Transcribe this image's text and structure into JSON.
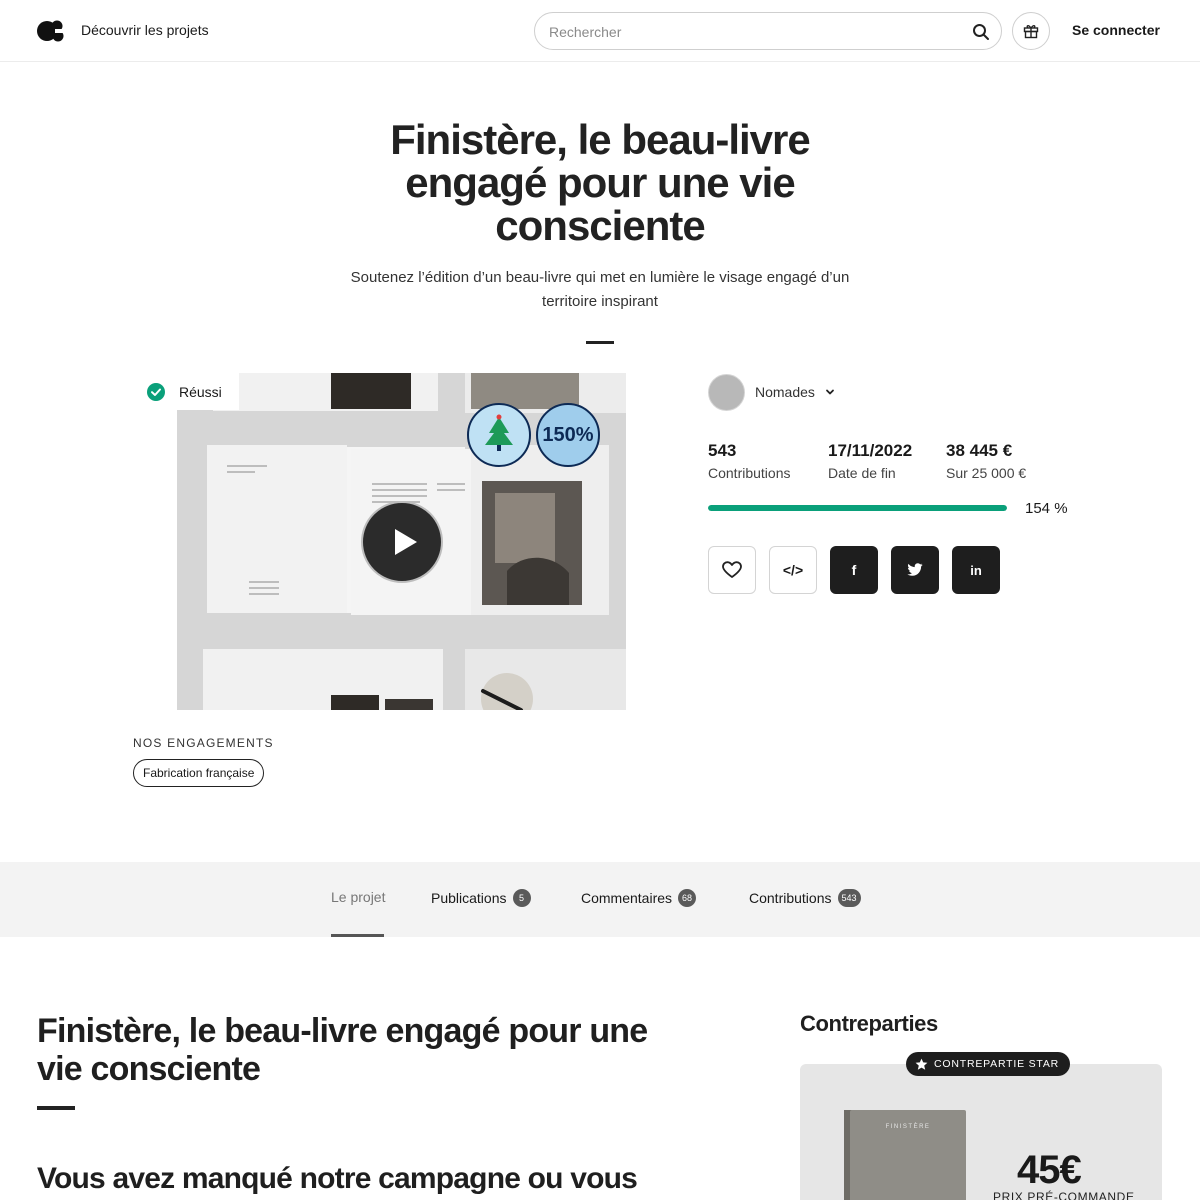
{
  "header": {
    "discover_label": "Découvrir les projets",
    "search_placeholder": "Rechercher",
    "login_label": "Se connecter"
  },
  "hero": {
    "title": "Finistère, le beau-livre engagé pour une vie consciente",
    "subtitle": "Soutenez l’édition d’un beau-livre qui met en lumière le visage engagé d’un territoire inspirant"
  },
  "media": {
    "status_label": "Réussi",
    "sticker_percent": "150%",
    "accent_color": "#0aa07a"
  },
  "owner": {
    "name": "Nomades"
  },
  "stats": [
    {
      "value": "543",
      "label": "Contributions"
    },
    {
      "value": "17/11/2022",
      "label": "Date de fin"
    },
    {
      "value": "38 445 €",
      "label": "Sur 25 000 €"
    }
  ],
  "progress": {
    "percent_label": "154 %",
    "fraction": 1.0
  },
  "actions": {
    "embed_label": "</>",
    "facebook_label": "f",
    "linkedin_label": "in"
  },
  "engagements": {
    "title": "NOS ENGAGEMENTS",
    "tags": [
      "Fabrication française"
    ]
  },
  "tabs": [
    {
      "label": "Le projet",
      "count": ""
    },
    {
      "label": "Publications",
      "count": "5"
    },
    {
      "label": "Commentaires",
      "count": "68"
    },
    {
      "label": "Contributions",
      "count": "543"
    }
  ],
  "content": {
    "title": "Finistère, le beau-livre engagé pour une vie consciente",
    "heading2": "Vous avez manqué notre campagne ou vous"
  },
  "rewards": {
    "title": "Contreparties",
    "star_badge": "CONTREPARTIE STAR",
    "book_title": "FINISTÈRE",
    "price": "45€",
    "price_label": "PRIX PRÉ-COMMANDE"
  }
}
